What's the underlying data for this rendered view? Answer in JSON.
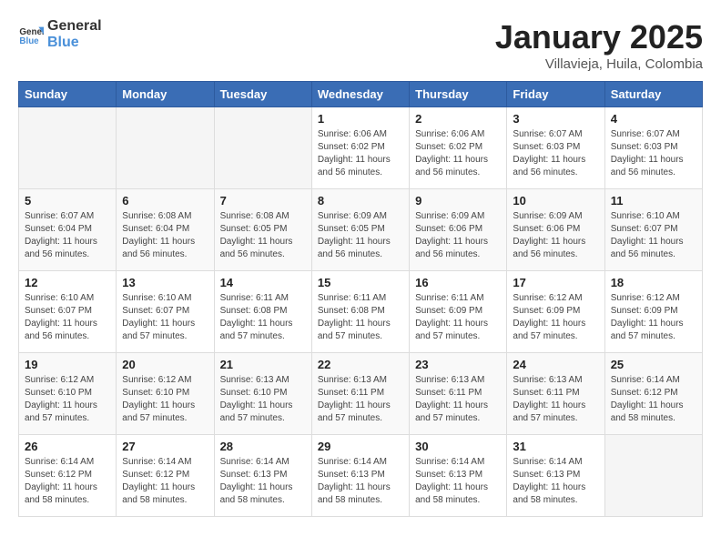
{
  "header": {
    "logo_general": "General",
    "logo_blue": "Blue",
    "title": "January 2025",
    "location": "Villavieja, Huila, Colombia"
  },
  "weekdays": [
    "Sunday",
    "Monday",
    "Tuesday",
    "Wednesday",
    "Thursday",
    "Friday",
    "Saturday"
  ],
  "weeks": [
    [
      {
        "day": "",
        "info": ""
      },
      {
        "day": "",
        "info": ""
      },
      {
        "day": "",
        "info": ""
      },
      {
        "day": "1",
        "info": "Sunrise: 6:06 AM\nSunset: 6:02 PM\nDaylight: 11 hours and 56 minutes."
      },
      {
        "day": "2",
        "info": "Sunrise: 6:06 AM\nSunset: 6:02 PM\nDaylight: 11 hours and 56 minutes."
      },
      {
        "day": "3",
        "info": "Sunrise: 6:07 AM\nSunset: 6:03 PM\nDaylight: 11 hours and 56 minutes."
      },
      {
        "day": "4",
        "info": "Sunrise: 6:07 AM\nSunset: 6:03 PM\nDaylight: 11 hours and 56 minutes."
      }
    ],
    [
      {
        "day": "5",
        "info": "Sunrise: 6:07 AM\nSunset: 6:04 PM\nDaylight: 11 hours and 56 minutes."
      },
      {
        "day": "6",
        "info": "Sunrise: 6:08 AM\nSunset: 6:04 PM\nDaylight: 11 hours and 56 minutes."
      },
      {
        "day": "7",
        "info": "Sunrise: 6:08 AM\nSunset: 6:05 PM\nDaylight: 11 hours and 56 minutes."
      },
      {
        "day": "8",
        "info": "Sunrise: 6:09 AM\nSunset: 6:05 PM\nDaylight: 11 hours and 56 minutes."
      },
      {
        "day": "9",
        "info": "Sunrise: 6:09 AM\nSunset: 6:06 PM\nDaylight: 11 hours and 56 minutes."
      },
      {
        "day": "10",
        "info": "Sunrise: 6:09 AM\nSunset: 6:06 PM\nDaylight: 11 hours and 56 minutes."
      },
      {
        "day": "11",
        "info": "Sunrise: 6:10 AM\nSunset: 6:07 PM\nDaylight: 11 hours and 56 minutes."
      }
    ],
    [
      {
        "day": "12",
        "info": "Sunrise: 6:10 AM\nSunset: 6:07 PM\nDaylight: 11 hours and 56 minutes."
      },
      {
        "day": "13",
        "info": "Sunrise: 6:10 AM\nSunset: 6:07 PM\nDaylight: 11 hours and 57 minutes."
      },
      {
        "day": "14",
        "info": "Sunrise: 6:11 AM\nSunset: 6:08 PM\nDaylight: 11 hours and 57 minutes."
      },
      {
        "day": "15",
        "info": "Sunrise: 6:11 AM\nSunset: 6:08 PM\nDaylight: 11 hours and 57 minutes."
      },
      {
        "day": "16",
        "info": "Sunrise: 6:11 AM\nSunset: 6:09 PM\nDaylight: 11 hours and 57 minutes."
      },
      {
        "day": "17",
        "info": "Sunrise: 6:12 AM\nSunset: 6:09 PM\nDaylight: 11 hours and 57 minutes."
      },
      {
        "day": "18",
        "info": "Sunrise: 6:12 AM\nSunset: 6:09 PM\nDaylight: 11 hours and 57 minutes."
      }
    ],
    [
      {
        "day": "19",
        "info": "Sunrise: 6:12 AM\nSunset: 6:10 PM\nDaylight: 11 hours and 57 minutes."
      },
      {
        "day": "20",
        "info": "Sunrise: 6:12 AM\nSunset: 6:10 PM\nDaylight: 11 hours and 57 minutes."
      },
      {
        "day": "21",
        "info": "Sunrise: 6:13 AM\nSunset: 6:10 PM\nDaylight: 11 hours and 57 minutes."
      },
      {
        "day": "22",
        "info": "Sunrise: 6:13 AM\nSunset: 6:11 PM\nDaylight: 11 hours and 57 minutes."
      },
      {
        "day": "23",
        "info": "Sunrise: 6:13 AM\nSunset: 6:11 PM\nDaylight: 11 hours and 57 minutes."
      },
      {
        "day": "24",
        "info": "Sunrise: 6:13 AM\nSunset: 6:11 PM\nDaylight: 11 hours and 57 minutes."
      },
      {
        "day": "25",
        "info": "Sunrise: 6:14 AM\nSunset: 6:12 PM\nDaylight: 11 hours and 58 minutes."
      }
    ],
    [
      {
        "day": "26",
        "info": "Sunrise: 6:14 AM\nSunset: 6:12 PM\nDaylight: 11 hours and 58 minutes."
      },
      {
        "day": "27",
        "info": "Sunrise: 6:14 AM\nSunset: 6:12 PM\nDaylight: 11 hours and 58 minutes."
      },
      {
        "day": "28",
        "info": "Sunrise: 6:14 AM\nSunset: 6:13 PM\nDaylight: 11 hours and 58 minutes."
      },
      {
        "day": "29",
        "info": "Sunrise: 6:14 AM\nSunset: 6:13 PM\nDaylight: 11 hours and 58 minutes."
      },
      {
        "day": "30",
        "info": "Sunrise: 6:14 AM\nSunset: 6:13 PM\nDaylight: 11 hours and 58 minutes."
      },
      {
        "day": "31",
        "info": "Sunrise: 6:14 AM\nSunset: 6:13 PM\nDaylight: 11 hours and 58 minutes."
      },
      {
        "day": "",
        "info": ""
      }
    ]
  ]
}
